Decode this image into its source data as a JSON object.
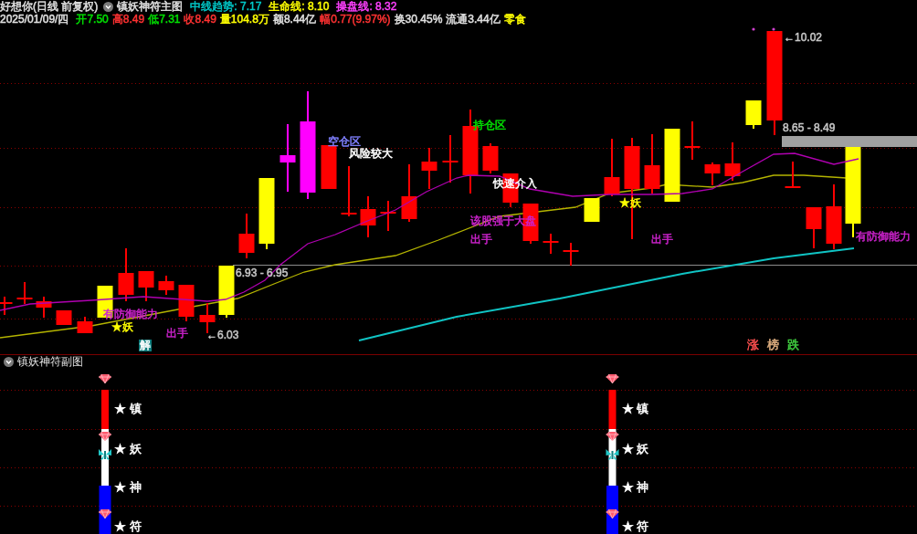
{
  "header": {
    "security": "好想你(日线 前复权)",
    "indicator": "镇妖神符主图",
    "lines": [
      {
        "text": "中线趋势: 7.17",
        "color": "#00c8c8"
      },
      {
        "text": "生命线: 8.10",
        "color": "#ffff00"
      },
      {
        "text": "操盘线: 8.32",
        "color": "#ff40ff"
      }
    ]
  },
  "quote": {
    "date": "2025/01/09/四",
    "fields": [
      {
        "text": "开7.50",
        "color": "#00e000"
      },
      {
        "text": "高8.49",
        "color": "#ff3232"
      },
      {
        "text": "低7.31",
        "color": "#00e000"
      },
      {
        "text": "收8.49",
        "color": "#ff3232"
      },
      {
        "text": "量104.8万",
        "color": "#ffff00"
      },
      {
        "text": "额8.44亿",
        "color": "#e0e0e0"
      },
      {
        "text": "幅0.77(9.97%)",
        "color": "#ff3232"
      },
      {
        "text": "换30.45%",
        "color": "#e0e0e0"
      },
      {
        "text": "流通3.44亿",
        "color": "#e0e0e0"
      },
      {
        "text": "零食",
        "color": "#ffff00"
      }
    ]
  },
  "main_chart": {
    "annotations": [
      {
        "text": "空仓区",
        "color": "#8080ff"
      },
      {
        "text": "风险较大",
        "color": "#ffffff"
      },
      {
        "text": "持仓区",
        "color": "#00e000"
      },
      {
        "text": "快速介入",
        "color": "#ffffff"
      },
      {
        "text": "★妖",
        "color": "#ffff00"
      },
      {
        "text": "该股强于大盘",
        "color": "#cc22cc"
      },
      {
        "text": "出手",
        "color": "#cc22cc"
      },
      {
        "text": "出手",
        "color": "#cc22cc"
      },
      {
        "text": "有防御能力",
        "color": "#cc22cc"
      },
      {
        "text": "有防御能力",
        "color": "#cc22cc"
      },
      {
        "text": "★妖",
        "color": "#ffff00"
      },
      {
        "text": "出手",
        "color": "#cc22cc"
      }
    ],
    "price_marks": [
      "6.93 - 6.95",
      "←6.03",
      "8.65 - 8.49",
      "←10.02"
    ],
    "signal_tag": "解",
    "rank_tags": [
      {
        "text": "涨",
        "color": "#ff5050"
      },
      {
        "text": "榜",
        "color": "#e0b080"
      },
      {
        "text": "跌",
        "color": "#40d040"
      }
    ]
  },
  "sub_chart": {
    "title": "镇妖神符副图",
    "signals": [
      {
        "markers": [
          "★ 镇",
          "★ 妖",
          "★ 神",
          "★ 符"
        ]
      },
      {
        "markers": [
          "★ 镇",
          "★ 妖",
          "★ 神",
          "★ 符"
        ]
      }
    ]
  }
}
